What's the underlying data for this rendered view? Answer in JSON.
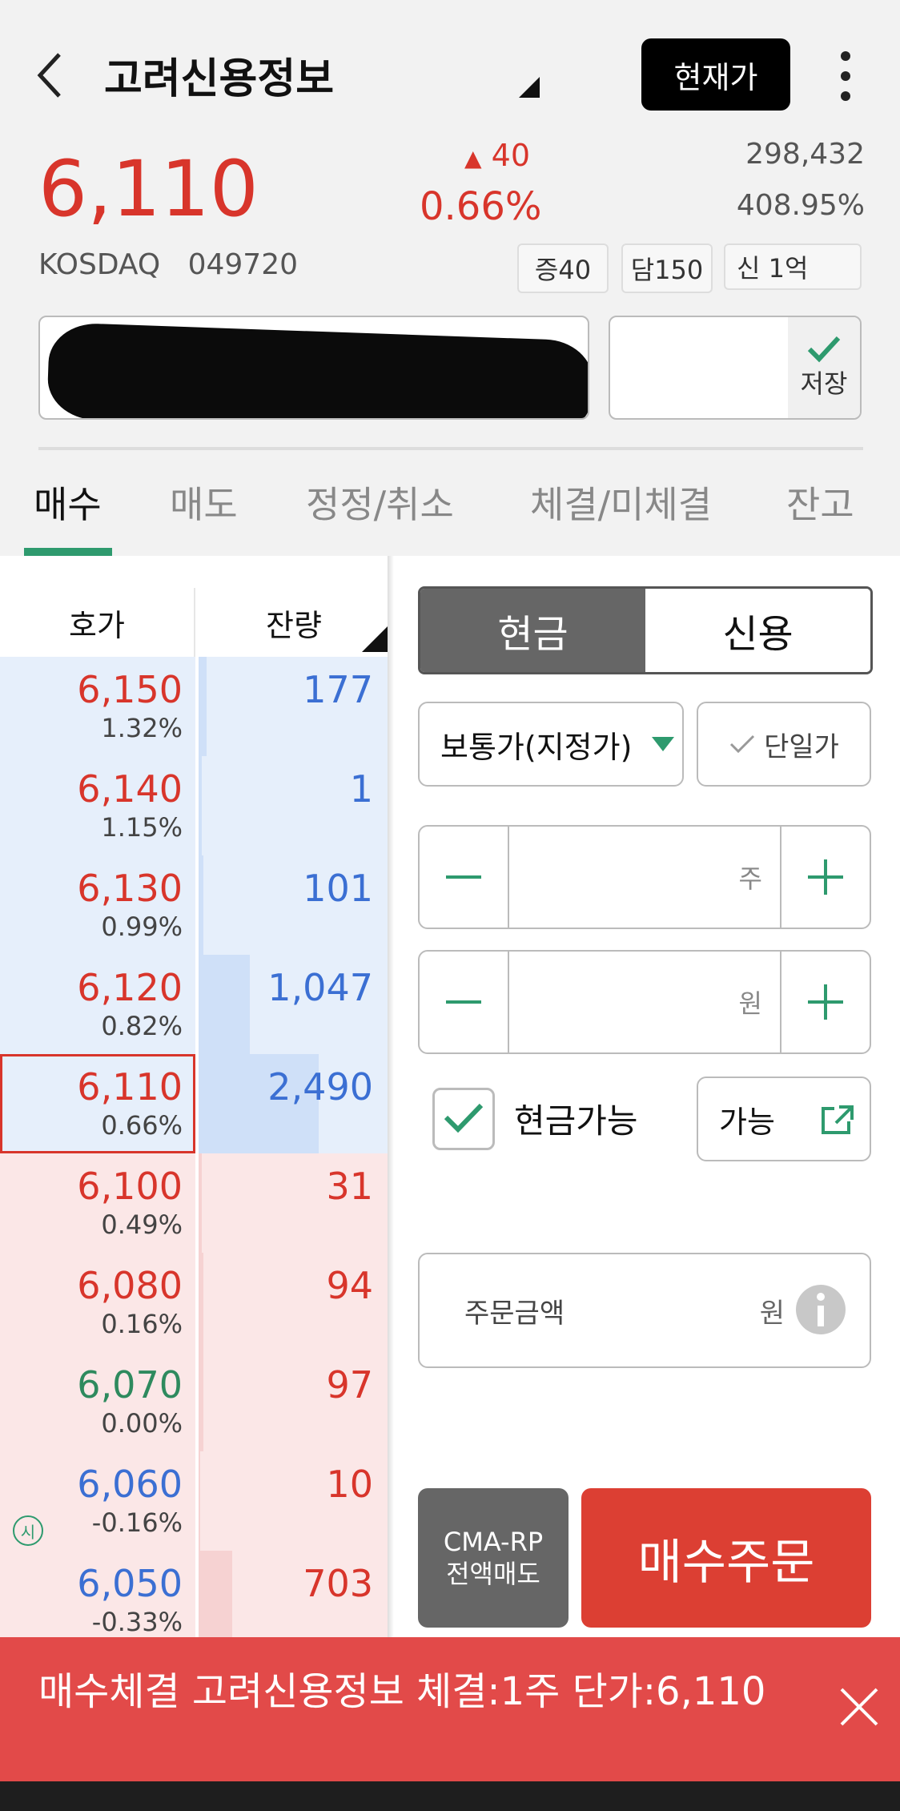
{
  "header": {
    "title": "고려신용정보",
    "current_price_button": "현재가"
  },
  "quote": {
    "price": "6,110",
    "change": "40",
    "change_pct": "0.66%",
    "volume": "298,432",
    "volume_ratio": "408.95%",
    "market": "KOSDAQ",
    "code": "049720",
    "tags": [
      "증40",
      "담150",
      "신 1억"
    ]
  },
  "account": {
    "save_label": "저장"
  },
  "tabs": [
    "매수",
    "매도",
    "정정/취소",
    "체결/미체결",
    "잔고"
  ],
  "orderbook": {
    "headers": [
      "호가",
      "잔량"
    ],
    "rows": [
      {
        "price": "6,150",
        "rate": "1.32%",
        "qty": "177"
      },
      {
        "price": "6,140",
        "rate": "1.15%",
        "qty": "1"
      },
      {
        "price": "6,130",
        "rate": "0.99%",
        "qty": "101"
      },
      {
        "price": "6,120",
        "rate": "0.82%",
        "qty": "1,047"
      },
      {
        "price": "6,110",
        "rate": "0.66%",
        "qty": "2,490"
      },
      {
        "price": "6,100",
        "rate": "0.49%",
        "qty": "31"
      },
      {
        "price": "6,080",
        "rate": "0.16%",
        "qty": "94"
      },
      {
        "price": "6,070",
        "rate": "0.00%",
        "qty": "97"
      },
      {
        "price": "6,060",
        "rate": "-0.16%",
        "qty": "10"
      },
      {
        "price": "6,050",
        "rate": "-0.33%",
        "qty": "703"
      }
    ],
    "open_marker": "시"
  },
  "order": {
    "segment": [
      "현금",
      "신용"
    ],
    "order_type": "보통가(지정가)",
    "single_price": "단일가",
    "qty_unit": "주",
    "price_unit": "원",
    "cash_available_label": "현금가능",
    "available_button": "가능",
    "amount_label": "주문금액",
    "amount_unit": "원",
    "cma_line1": "CMA-RP",
    "cma_line2": "전액매도",
    "buy_button": "매수주문"
  },
  "toast": {
    "message": "매수체결 고려신용정보 체결:1주 단가:6,110"
  },
  "colors": {
    "up": "#d8352b",
    "down": "#3b6fd3",
    "flat": "#2e8a5e",
    "accent": "#2e9a6e",
    "buy": "#dc3f33"
  }
}
